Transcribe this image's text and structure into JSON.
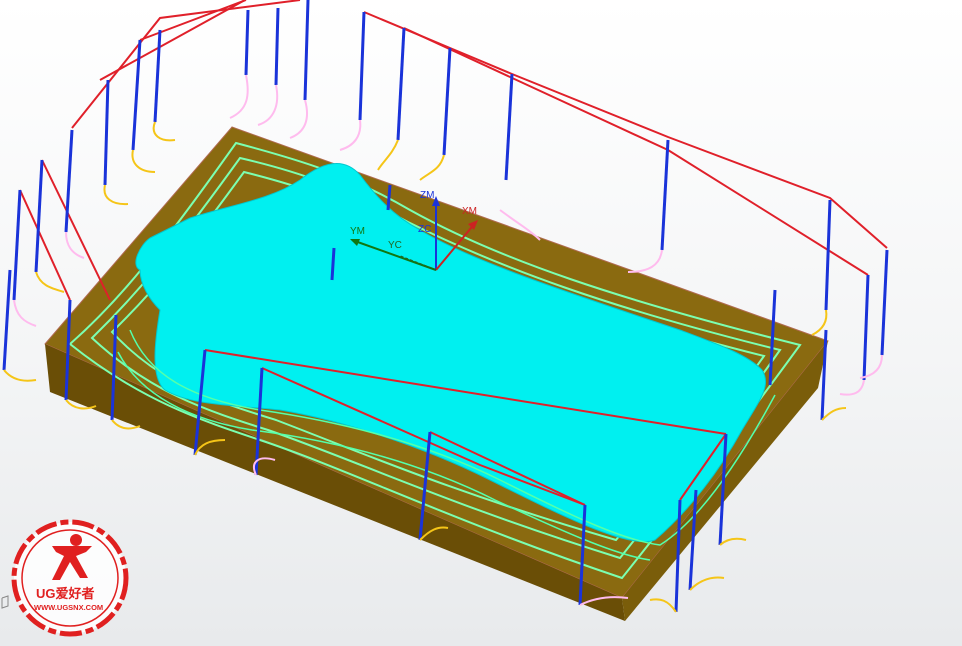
{
  "viewport": {
    "wcs_labels": {
      "zm": "ZM",
      "xm": "XM",
      "ym": "YM",
      "zc": "ZC",
      "yc": "YC"
    }
  },
  "logo": {
    "brand": "UG爱好者",
    "url": "WWW.UGSNX.COM"
  },
  "colors": {
    "part_surface": "#00f0f0",
    "stock_top": "#8a6a10",
    "stock_side": "#6f5208",
    "cut_path": "#66ff99",
    "engage_move": "#1a33d9",
    "rapid_move": "#e0202a",
    "retract_arc": "#ffbbee",
    "engage_arc": "#f5c518",
    "logo_red": "#e02020"
  }
}
